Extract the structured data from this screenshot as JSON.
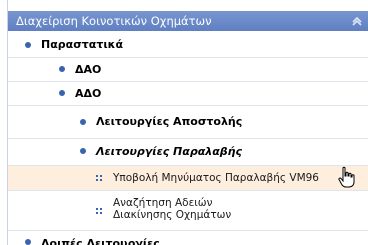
{
  "header": {
    "title": "Διαχείριση Κοινοτικών Οχημάτων"
  },
  "menu": {
    "parastatika": "Παραστατικά",
    "dao_upper": "ΔΑΟ",
    "ado": "ΑΔΟ",
    "send_ops": "Λειτουργίες Αποστολής",
    "receive_ops": "Λειτουργίες Παραλαβής",
    "submit_receipt": "Υποβολή Μηνύματος Παραλαβής VM96",
    "search_permits": "Αναζήτηση Αδειών Διακίνησης Οχημάτων",
    "other_ops": "Λοιπές Λειτουργίες"
  },
  "colors": {
    "header": "#6a87c8",
    "bullet": "#3a63b0",
    "highlight": "#fdeede"
  }
}
